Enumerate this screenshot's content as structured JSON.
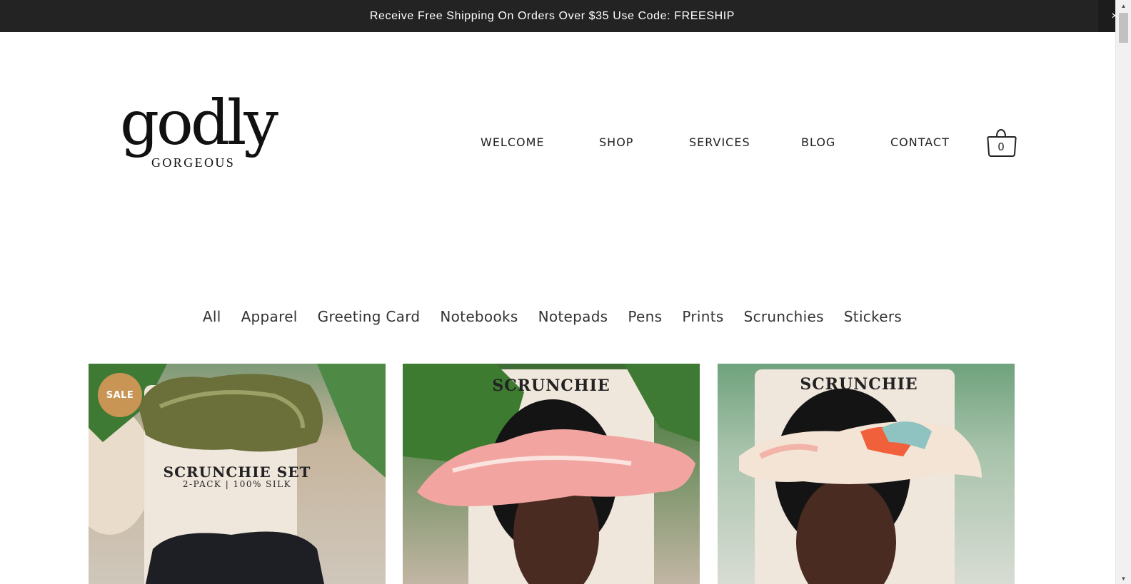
{
  "announcement": {
    "text": "Receive Free Shipping On Orders Over $35 Use Code: FREESHIP",
    "close_label": "×"
  },
  "logo": {
    "main": "godly",
    "sub": "GORGEOUS"
  },
  "nav": {
    "items": [
      "WELCOME",
      "SHOP",
      "SERVICES",
      "BLOG",
      "CONTACT"
    ]
  },
  "cart": {
    "count": "0",
    "icon": "shopping-bag-icon"
  },
  "filters": {
    "items": [
      "All",
      "Apparel",
      "Greeting Card",
      "Notebooks",
      "Notepads",
      "Pens",
      "Prints",
      "Scrunchies",
      "Stickers"
    ]
  },
  "products": [
    {
      "badge": "SALE",
      "card_title": "SCRUNCHIE SET",
      "card_subtitle": "2-PACK | 100% SILK"
    },
    {
      "card_title": "SCRUNCHIE"
    },
    {
      "card_title": "SCRUNCHIE"
    }
  ],
  "colors": {
    "announcement_bg": "#232323",
    "sale_badge": "#c99555",
    "page_bg": "#ffffff"
  }
}
